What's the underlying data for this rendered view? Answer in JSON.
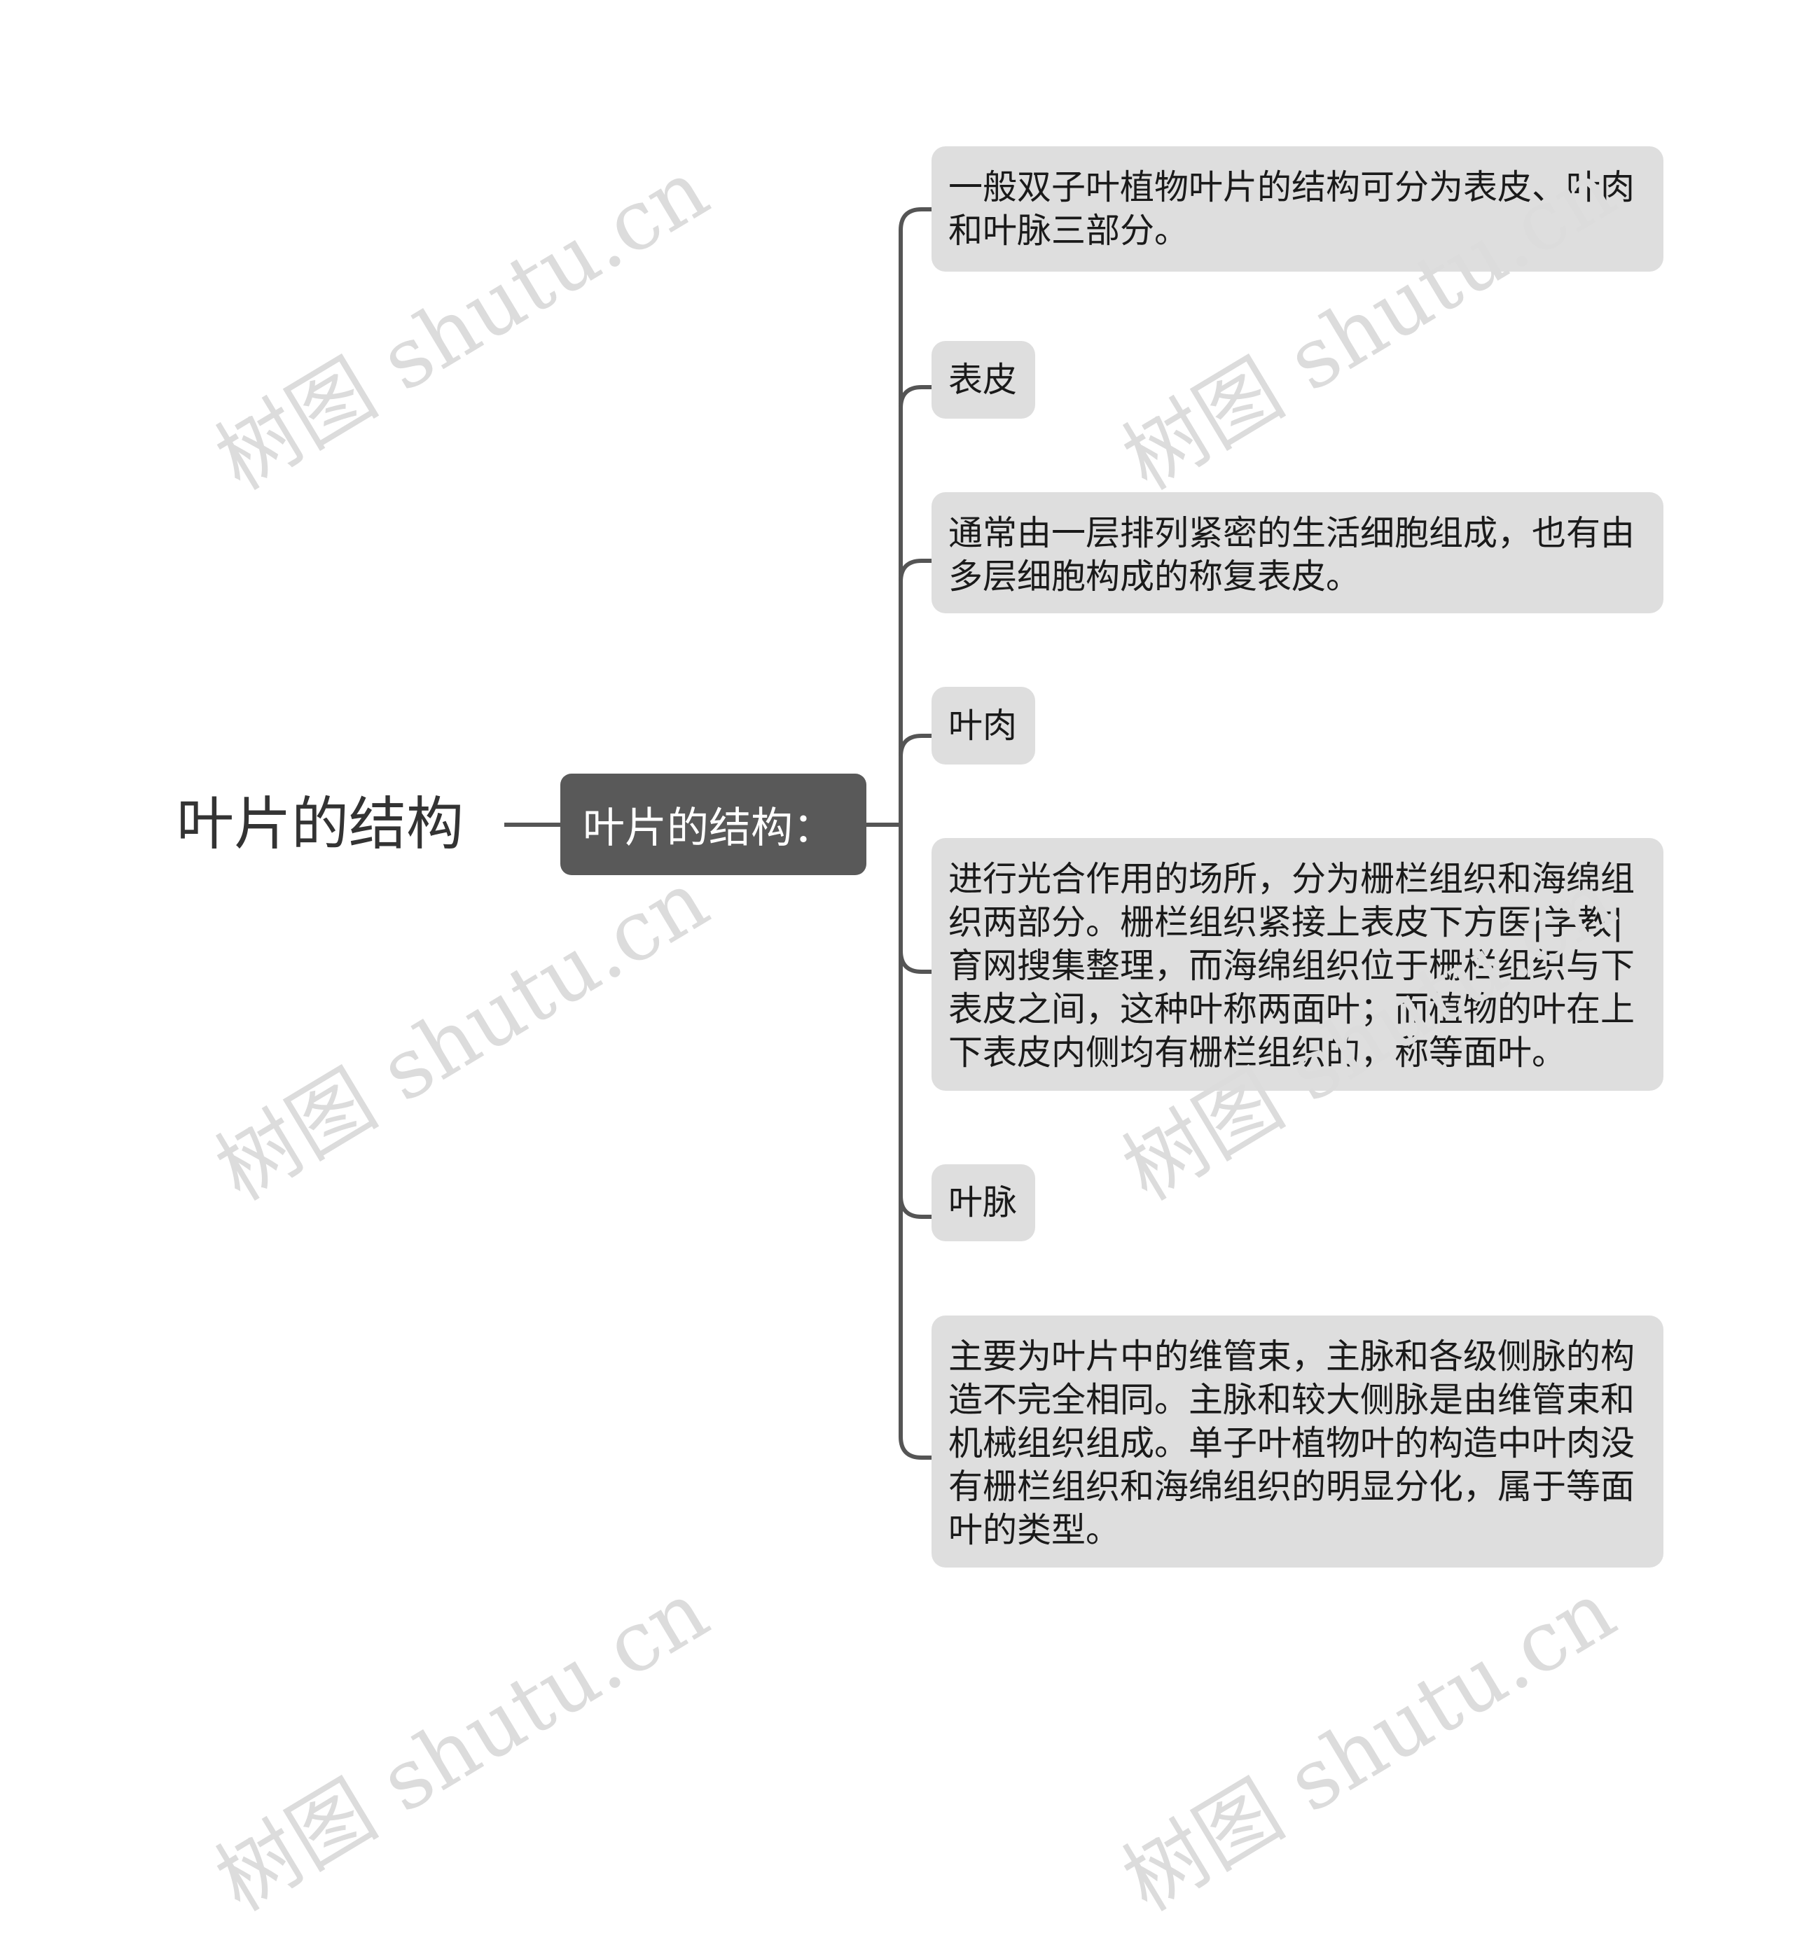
{
  "root": {
    "label": "叶片的结构"
  },
  "center": {
    "label": "叶片的结构："
  },
  "branches": [
    {
      "label": "一般双子叶植物叶片的结构可分为表皮、叶肉和叶脉三部分。",
      "type": "detail"
    },
    {
      "label": "表皮",
      "type": "heading"
    },
    {
      "label": "通常由一层排列紧密的生活细胞组成，也有由多层细胞构成的称复表皮。",
      "type": "detail"
    },
    {
      "label": "叶肉",
      "type": "heading"
    },
    {
      "label": "进行光合作用的场所，分为栅栏组织和海绵组织两部分。栅栏组织紧接上表皮下方医|学教|育网搜集整理，而海绵组织位于栅栏组织与下表皮之间，这种叶称两面叶；而植物的叶在上下表皮内侧均有栅栏组织的，称等面叶。",
      "type": "detail"
    },
    {
      "label": "叶脉",
      "type": "heading"
    },
    {
      "label": "主要为叶片中的维管束，主脉和各级侧脉的构造不完全相同。主脉和较大侧脉是由维管束和机械组织组成。单子叶植物叶的构造中叶肉没有栅栏组织和海绵组织的明显分化，属于等面叶的类型。",
      "type": "detail"
    }
  ],
  "watermark": {
    "text": "树图 shutu.cn"
  },
  "colors": {
    "center_node_bg": "#595959",
    "node_bg": "#dedede",
    "connector": "#555555",
    "watermark": "#dcdcdc",
    "root_text": "#333333"
  }
}
